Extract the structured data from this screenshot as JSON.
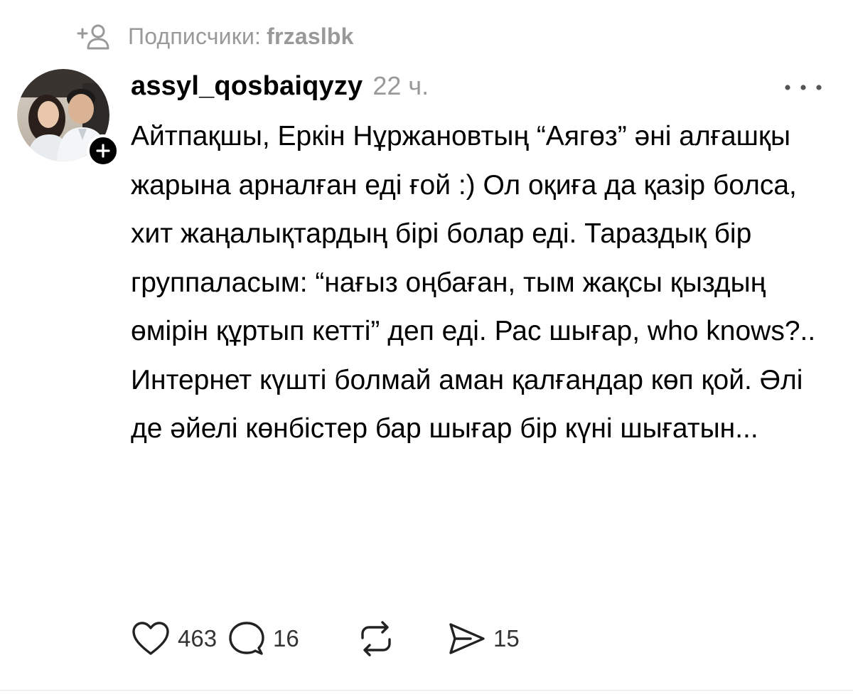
{
  "context": {
    "label": "Подписчики:",
    "user": "frzaslbk",
    "icon": "follow-person-plus-icon"
  },
  "post": {
    "author": "assyl_qosbaiqyzy",
    "time": "22 ч.",
    "body": [
      "Айтпақшы, Еркін Нұржановтың “Аягөз” әні алғашқы жарына арналған еді ғой :) Ол оқиға да қазір болса, хит жаңалықтардың бірі болар еді. Тараздық бір группаласым: “нағыз оңбаған, тым жақсы қыздың өмірін құртып кетті” деп еді. Рас шығар, who knows?..",
      "Интернет күшті болмай аман қалғандар көп қой. Әлі де әйелі көнбістер бар шығар бір күні шығатын..."
    ]
  },
  "actions": {
    "likes": "463",
    "replies": "16",
    "shares": "15"
  },
  "colors": {
    "text": "#000000",
    "muted": "#999999",
    "count": "#333333"
  }
}
